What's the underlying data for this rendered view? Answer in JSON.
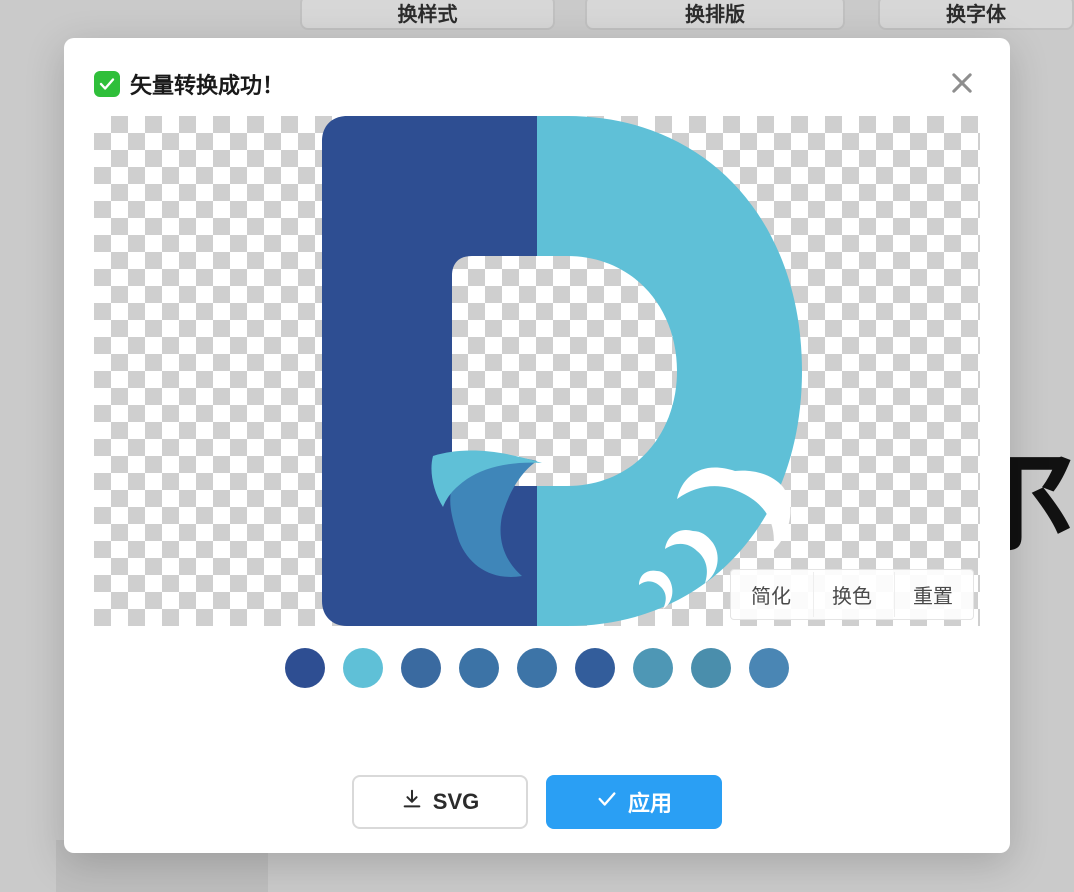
{
  "background": {
    "pill1": "换样式",
    "pill2": "换排版",
    "pill3": "换字体",
    "big_glyph": "尔"
  },
  "modal": {
    "title": "矢量转换成功！",
    "canvas_tools": {
      "simplify": "简化",
      "recolor": "换色",
      "reset": "重置"
    },
    "swatches": [
      "#2e4e92",
      "#5fc0d7",
      "#3a6aa0",
      "#3c73a6",
      "#3d74a7",
      "#335d9b",
      "#4e97b5",
      "#4a8eac",
      "#4a86b4"
    ],
    "footer": {
      "svg_label": "SVG",
      "apply_label": "应用"
    },
    "preview_colors": {
      "left": "#2e4e92",
      "right": "#5fc0d7"
    }
  }
}
